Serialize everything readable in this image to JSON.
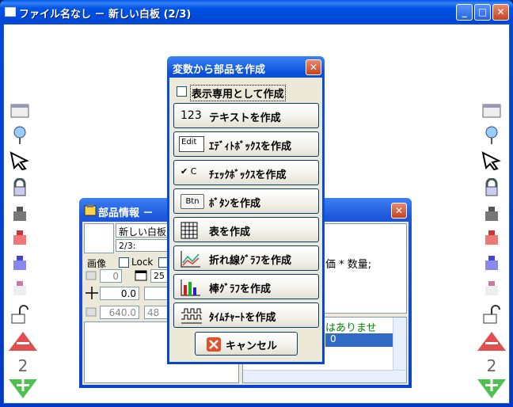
{
  "window": {
    "title": "ファイル名なし － 新しい白板 (2/3)",
    "minimize": "_",
    "maximize": "□",
    "close": "✕"
  },
  "toolbar": {
    "page_number": "2"
  },
  "parts_panel": {
    "title": "部品情報 －",
    "name_value": "新しい白板",
    "page_value": "2/3:",
    "image_label": "画像",
    "lock_label": "Lock",
    "num1": "0",
    "num2": "25",
    "pos_value": "0.0",
    "width_value": "640.0",
    "height_value": "48",
    "code_text": "価 * 数量;",
    "message_text": "はありませ",
    "selected_value": "0",
    "close": "✕"
  },
  "dialog": {
    "title": "変数から部品を作成",
    "close": "✕",
    "display_only_label": "表示専用として作成",
    "items": [
      {
        "icon_text": "123",
        "label": "テキストを作成"
      },
      {
        "icon_text": "Edit",
        "label": "ｴﾃﾞｨﾄﾎﾞｯｸｽを作成"
      },
      {
        "icon_text": "✔ C",
        "label": "ﾁｪｯｸﾎﾞｯｸｽを作成"
      },
      {
        "icon_text": "Btn",
        "label": "ﾎﾞﾀﾝを作成"
      },
      {
        "icon_text": "",
        "label": "表を作成"
      },
      {
        "icon_text": "",
        "label": "折れ線ｸﾞﾗﾌを作成"
      },
      {
        "icon_text": "",
        "label": "棒ｸﾞﾗﾌを作成"
      },
      {
        "icon_text": "",
        "label": "ﾀｲﾑﾁｬｰﾄを作成"
      }
    ],
    "cancel_label": "キャンセル"
  }
}
